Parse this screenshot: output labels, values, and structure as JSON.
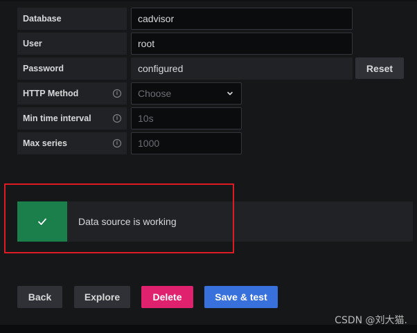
{
  "form": {
    "database": {
      "label": "Database",
      "value": "cadvisor"
    },
    "user": {
      "label": "User",
      "value": "root"
    },
    "password": {
      "label": "Password",
      "value": "configured",
      "reset_label": "Reset"
    },
    "http_method": {
      "label": "HTTP Method",
      "placeholder": "Choose"
    },
    "min_time_interval": {
      "label": "Min time interval",
      "placeholder": "10s"
    },
    "max_series": {
      "label": "Max series",
      "placeholder": "1000"
    }
  },
  "alert": {
    "message": "Data source is working",
    "status_color": "#1a7f4b"
  },
  "actions": {
    "back_label": "Back",
    "explore_label": "Explore",
    "delete_label": "Delete",
    "save_test_label": "Save & test"
  },
  "icons": {
    "info": "info-icon",
    "chevron": "chevron-down-icon",
    "check": "check-icon"
  },
  "watermark": "CSDN @刘大猫."
}
